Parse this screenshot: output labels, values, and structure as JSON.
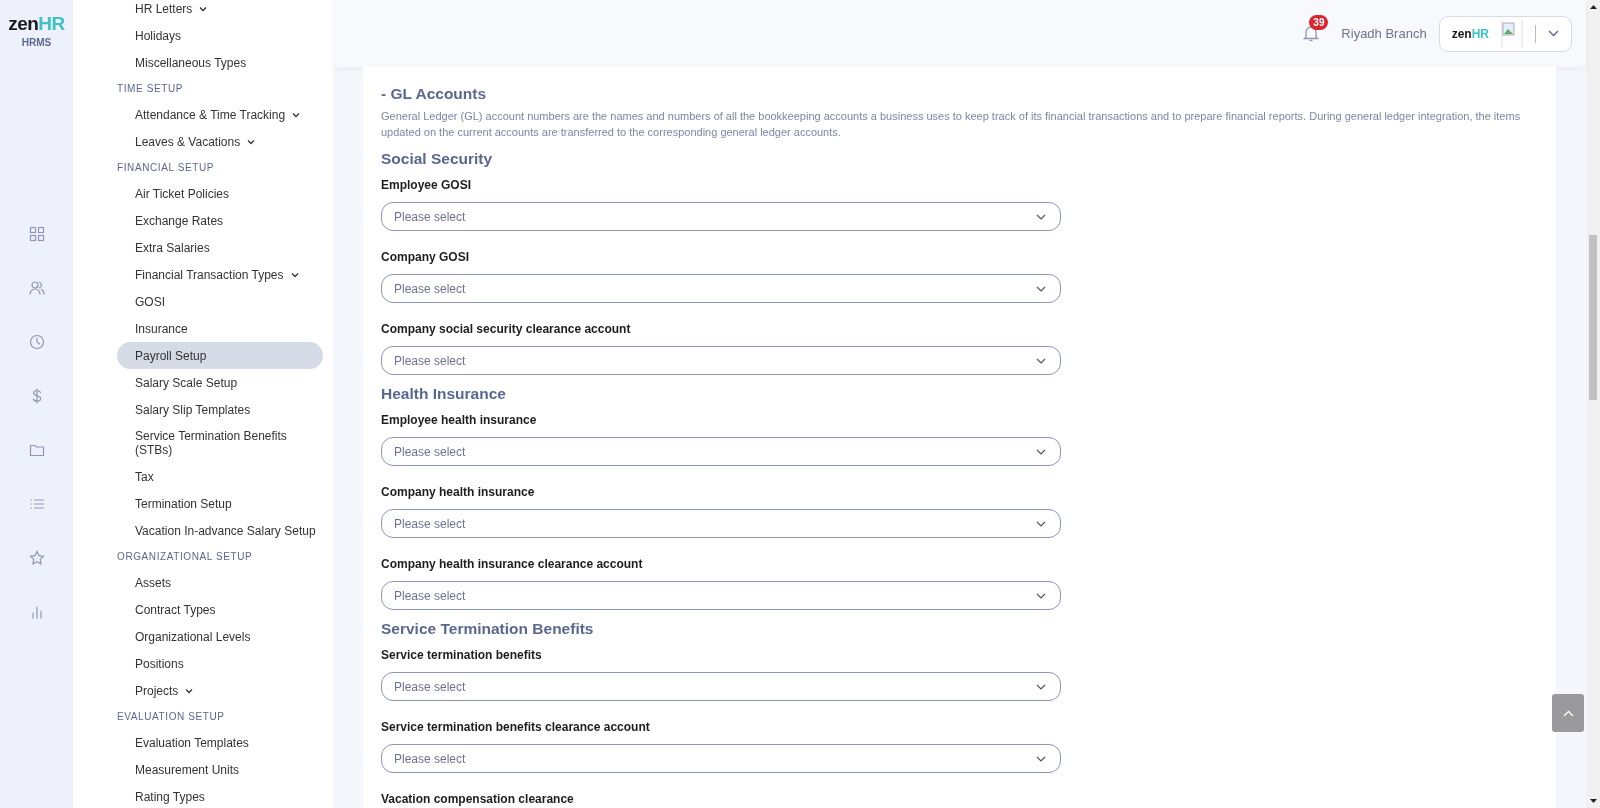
{
  "rail": {
    "logo": {
      "word": "zen",
      "accent": "HR",
      "subtitle": "HRMS"
    }
  },
  "sidebar": {
    "sections": [
      {
        "items": [
          {
            "label": "HR Letters",
            "has_submenu": true,
            "selected": false
          },
          {
            "label": "Holidays",
            "has_submenu": false,
            "selected": false
          },
          {
            "label": "Miscellaneous Types",
            "has_submenu": false,
            "selected": false
          }
        ]
      },
      {
        "title": "TIME SETUP",
        "items": [
          {
            "label": "Attendance & Time Tracking",
            "has_submenu": true,
            "selected": false
          },
          {
            "label": "Leaves & Vacations",
            "has_submenu": true,
            "selected": false
          }
        ]
      },
      {
        "title": "FINANCIAL SETUP",
        "items": [
          {
            "label": "Air Ticket Policies",
            "has_submenu": false,
            "selected": false
          },
          {
            "label": "Exchange Rates",
            "has_submenu": false,
            "selected": false
          },
          {
            "label": "Extra Salaries",
            "has_submenu": false,
            "selected": false
          },
          {
            "label": "Financial Transaction Types",
            "has_submenu": true,
            "selected": false
          },
          {
            "label": "GOSI",
            "has_submenu": false,
            "selected": false
          },
          {
            "label": "Insurance",
            "has_submenu": false,
            "selected": false
          },
          {
            "label": "Payroll Setup",
            "has_submenu": false,
            "selected": true
          },
          {
            "label": "Salary Scale Setup",
            "has_submenu": false,
            "selected": false
          },
          {
            "label": "Salary Slip Templates",
            "has_submenu": false,
            "selected": false
          },
          {
            "label": "Service Termination Benefits (STBs)",
            "has_submenu": false,
            "selected": false
          },
          {
            "label": "Tax",
            "has_submenu": false,
            "selected": false
          },
          {
            "label": "Termination Setup",
            "has_submenu": false,
            "selected": false
          },
          {
            "label": "Vacation In-advance Salary Setup",
            "has_submenu": false,
            "selected": false
          }
        ]
      },
      {
        "title": "ORGANIZATIONAL SETUP",
        "items": [
          {
            "label": "Assets",
            "has_submenu": false,
            "selected": false
          },
          {
            "label": "Contract Types",
            "has_submenu": false,
            "selected": false
          },
          {
            "label": "Organizational Levels",
            "has_submenu": false,
            "selected": false
          },
          {
            "label": "Positions",
            "has_submenu": false,
            "selected": false
          },
          {
            "label": "Projects",
            "has_submenu": true,
            "selected": false
          }
        ]
      },
      {
        "title": "EVALUATION SETUP",
        "items": [
          {
            "label": "Evaluation Templates",
            "has_submenu": false,
            "selected": false
          },
          {
            "label": "Measurement Units",
            "has_submenu": false,
            "selected": false
          },
          {
            "label": "Rating Types",
            "has_submenu": false,
            "selected": false
          }
        ]
      }
    ]
  },
  "header": {
    "notification_count": "39",
    "branch": "Riyadh Branch",
    "logo": {
      "word": "zen",
      "accent": "HR"
    }
  },
  "content": {
    "title": "- GL Accounts",
    "description": "General Ledger (GL) account numbers are the names and numbers of all the bookkeeping accounts a business uses to keep track of its financial transactions and to prepare financial reports. During general ledger integration, the items updated on the current accounts are transferred to the corresponding general ledger accounts.",
    "sections": [
      {
        "title": "Social Security",
        "fields": [
          {
            "label": "Employee GOSI",
            "placeholder": "Please select"
          },
          {
            "label": "Company GOSI",
            "placeholder": "Please select"
          },
          {
            "label": "Company social security clearance account",
            "placeholder": "Please select"
          }
        ]
      },
      {
        "title": "Health Insurance",
        "fields": [
          {
            "label": "Employee health insurance",
            "placeholder": "Please select"
          },
          {
            "label": "Company health insurance",
            "placeholder": "Please select"
          },
          {
            "label": "Company health insurance clearance account",
            "placeholder": "Please select"
          }
        ]
      },
      {
        "title": "Service Termination Benefits",
        "fields": [
          {
            "label": "Service termination benefits",
            "placeholder": "Please select"
          },
          {
            "label": "Service termination benefits clearance account",
            "placeholder": "Please select"
          },
          {
            "label": "Vacation compensation clearance"
          }
        ]
      }
    ]
  }
}
